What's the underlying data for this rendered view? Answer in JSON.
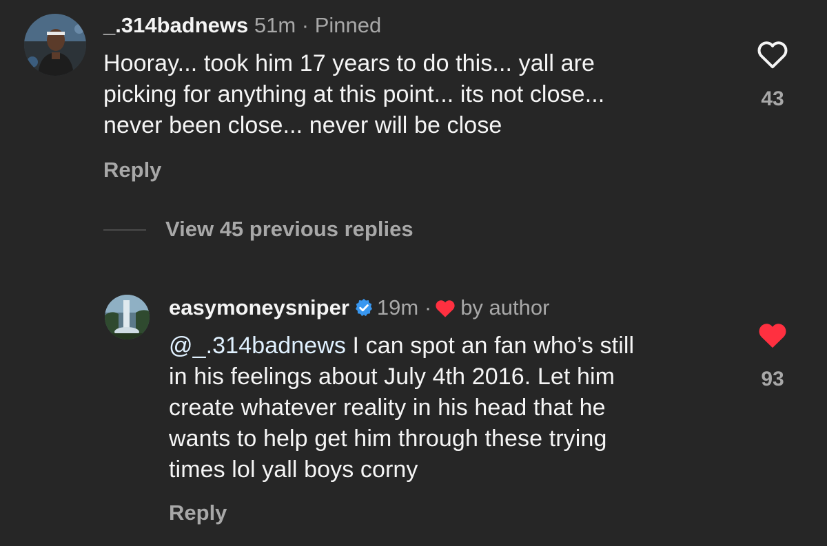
{
  "colors": {
    "background": "#262626",
    "text_primary": "#f5f5f5",
    "text_secondary": "#a8a8a8",
    "mention": "#e0f1ff",
    "verified_blue": "#3897f0",
    "like_red": "#ff3040"
  },
  "comment": {
    "username": "_.314badnews",
    "time": "51m",
    "separator": "·",
    "pinned_label": "Pinned",
    "lines": [
      "Hooray... took him 17 years to do this... yall are",
      "picking for anything at this point... its not close...",
      "never been close... never will be close"
    ],
    "reply_label": "Reply",
    "like_icon": "heart-outline-icon",
    "like_count": "43"
  },
  "view_replies_label": "View 45 previous replies",
  "reply": {
    "username": "easymoneysniper",
    "verified_icon": "verified-badge-icon",
    "time": "19m",
    "separator": "·",
    "liked_by_label": "by author",
    "mention": "@_.314badnews",
    "lines": [
      " I can spot an fan who’s still",
      "in his feelings about July 4th 2016. Let him",
      "create whatever reality in his head that he",
      "wants to help get him through these trying",
      "times lol yall boys corny"
    ],
    "reply_label": "Reply",
    "like_icon": "heart-filled-icon",
    "like_count": "93"
  }
}
